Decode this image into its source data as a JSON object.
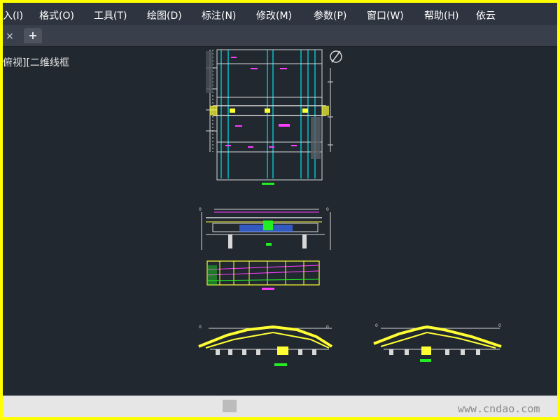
{
  "menu": {
    "items": [
      {
        "label": "入(I)"
      },
      {
        "label": "格式(O)"
      },
      {
        "label": "工具(T)"
      },
      {
        "label": "绘图(D)"
      },
      {
        "label": "标注(N)"
      },
      {
        "label": "修改(M)"
      },
      {
        "label": "参数(P)"
      },
      {
        "label": "窗口(W)"
      },
      {
        "label": "帮助(H)"
      },
      {
        "label": "依云"
      }
    ]
  },
  "tabs": {
    "close_glyph": "×",
    "add_glyph": "+"
  },
  "viewport": {
    "view_label": "俯视][二维线框"
  },
  "watermark": {
    "text": "www.cndao.com"
  },
  "colors": {
    "canvas_bg": "#212830",
    "frame": "#ffff00",
    "cyan": "#00e5ee",
    "magenta": "#ff3cff",
    "yellow": "#ffff33",
    "green": "#22ee22",
    "white": "#d8d8d8"
  }
}
